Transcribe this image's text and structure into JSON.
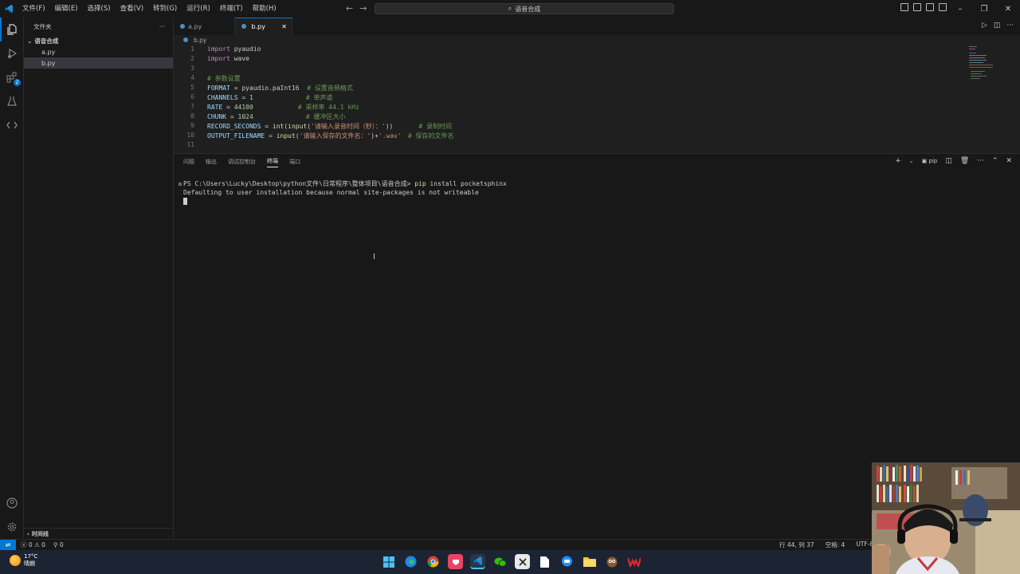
{
  "colors": {
    "accent": "#0078d4",
    "bg": "#1f1f1f",
    "sidebar": "#181818"
  },
  "menu": [
    "文件(F)",
    "编辑(E)",
    "选择(S)",
    "查看(V)",
    "转到(G)",
    "运行(R)",
    "终端(T)",
    "帮助(H)"
  ],
  "command_center": "语音合成",
  "sidebar": {
    "title": "文件夹",
    "folder": "语音合成",
    "files": [
      "a.py",
      "b.py"
    ],
    "outline": "时间线"
  },
  "activity_badge": "2",
  "tabs": [
    {
      "label": "a.py"
    },
    {
      "label": "b.py"
    }
  ],
  "breadcrumb": "b.py",
  "code": [
    {
      "n": "1"
    },
    {
      "n": "2"
    },
    {
      "n": "3"
    },
    {
      "n": "4"
    },
    {
      "n": "5"
    },
    {
      "n": "6"
    },
    {
      "n": "7"
    },
    {
      "n": "8"
    },
    {
      "n": "9"
    },
    {
      "n": "10"
    },
    {
      "n": "11"
    }
  ],
  "code_text": {
    "l1": [
      "import",
      "pyaudio"
    ],
    "l2": [
      "import",
      "wave"
    ],
    "l4": "# 参数设置",
    "l5": [
      "FORMAT",
      " = pyaudio.paInt16  ",
      "# 设置音频格式"
    ],
    "l6": [
      "CHANNELS",
      " = ",
      "1",
      "# 单声道"
    ],
    "l7": [
      "RATE",
      " = ",
      "44100",
      "# 采样率 44.1 kHz"
    ],
    "l8": [
      "CHUNK",
      " = ",
      "1024",
      "# 缓冲区大小"
    ],
    "l9": [
      "RECORD_SECONDS",
      " = ",
      "int",
      "(",
      "input",
      "(",
      "'请输入录音时间（秒）：'",
      "))",
      "# 录制时间"
    ],
    "l10": [
      "OUTPUT_FILENAME",
      " = ",
      "input",
      "(",
      "'请输入保存的文件名：'",
      ")+",
      "'.wav'",
      "# 保存的文件名"
    ]
  },
  "panel": {
    "tabs": [
      "问题",
      "输出",
      "调试控制台",
      "终端",
      "端口"
    ],
    "active_tab": "终端",
    "shell": "pip",
    "terminal_lines": [
      {
        "prompt": "PS C:\\Users\\Lucky\\Desktop\\python文件\\日常程序\\整体项目\\语音合成> ",
        "cmd": "pip",
        "args": " install pocketsphinx"
      },
      {
        "text": "Defaulting to user installation because normal site-packages is not writeable"
      }
    ]
  },
  "status": {
    "errors": "0",
    "warnings": "0",
    "ports": "0",
    "position": "行 44, 列 37",
    "spaces": "空格: 4",
    "encoding": "UTF-8"
  },
  "weather": {
    "temp": "17°C",
    "desc": "晴朗"
  }
}
